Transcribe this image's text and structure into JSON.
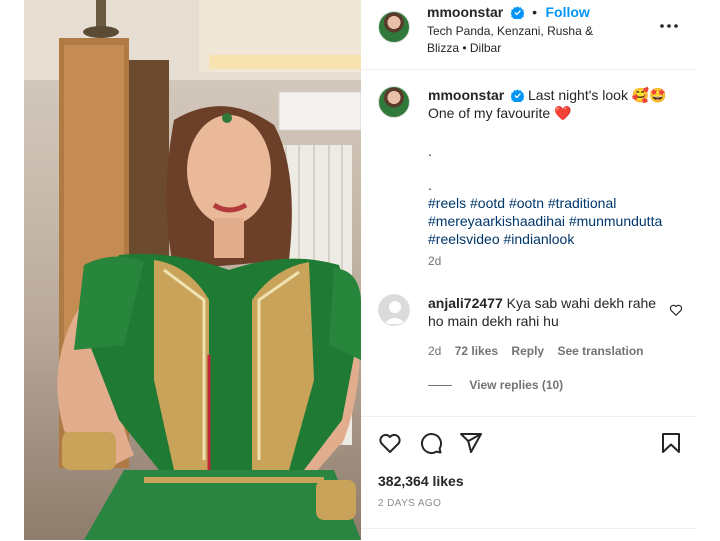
{
  "post": {
    "username": "mmoonstar",
    "follow_label": "Follow",
    "separator": "•",
    "audio_line": "Tech Panda, Kenzani, Rusha &",
    "audio_line2": "Blizza • Dilbar"
  },
  "caption": {
    "username": "mmoonstar",
    "line1": "Last night's look 🥰🤩",
    "line2": "One of my favourite",
    "heart": "❤️",
    "dot1": ".",
    "dot2": ".",
    "hashtags_line1": "#reels #ootd #ootn #traditional",
    "hashtags_line2": "#mereyaarkishaadihai #munmundutta",
    "hashtags_line3": "#reelsvideo #indianlook",
    "time": "2d"
  },
  "comment": {
    "username": "anjali72477",
    "text_line1": "Kya sab wahi dekh rahe",
    "text_line2": "ho main dekh rahi hu",
    "time": "2d",
    "likes": "72 likes",
    "reply_label": "Reply",
    "translate_label": "See translation",
    "view_replies": "View replies (10)"
  },
  "stats": {
    "likes": "382,364 likes",
    "posted": "2 DAYS AGO"
  },
  "icons": {
    "verified": "verified-badge-icon",
    "more": "more-options-icon",
    "like": "heart-icon",
    "comment": "comment-icon",
    "share": "share-icon",
    "save": "bookmark-icon"
  },
  "colors": {
    "link_blue": "#0095f6",
    "hashtag_blue": "#00376b",
    "muted": "#737373"
  }
}
